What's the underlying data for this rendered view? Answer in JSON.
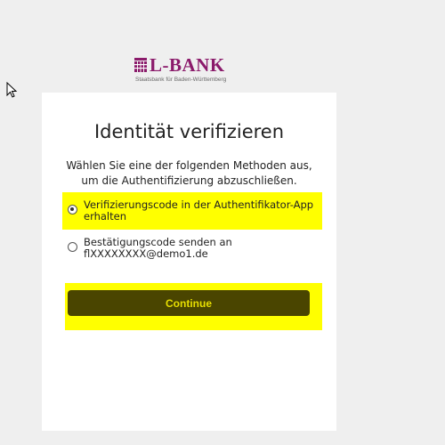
{
  "logo": {
    "brand": "L-BANK",
    "subtitle": "Staatsbank für Baden-Württemberg",
    "brand_color": "#8b1b6b"
  },
  "card": {
    "title": "Identität verifizieren",
    "description": "Wählen Sie eine der folgenden Methoden aus, um die Authentifizierung abzuschließen.",
    "options": [
      {
        "label": "Verifizierungscode in der Authentifikator-App erhalten",
        "selected": true,
        "highlighted": true
      },
      {
        "label": "Bestätigungscode senden an flXXXXXXXX@demo1.de",
        "selected": false,
        "highlighted": false
      }
    ],
    "continue_label": "Continue"
  },
  "colors": {
    "background": "#efefef",
    "card": "#ffffff",
    "highlight": "#ffff00",
    "button_bg": "#4a4500",
    "button_text": "#e8df00"
  },
  "icons": {
    "cursor": "mouse-pointer-icon",
    "logo_emblem": "coat-of-arms-icon"
  }
}
